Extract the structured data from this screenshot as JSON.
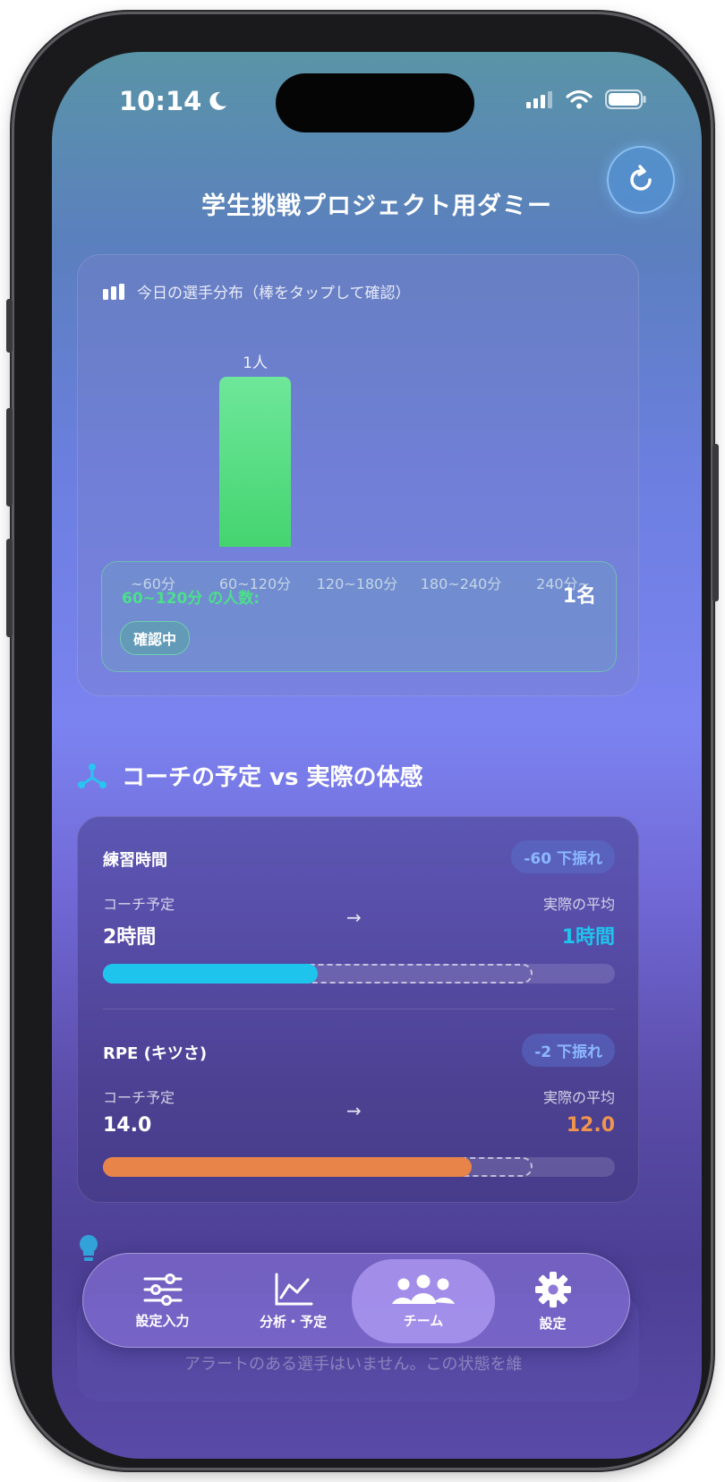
{
  "status_bar": {
    "time": "10:14"
  },
  "header": {
    "title": "学生挑戦プロジェクト用ダミー"
  },
  "distribution": {
    "title": "今日の選手分布（棒をタップして確認）",
    "selected_label": "60~120分 の人数:",
    "selected_value": "1名",
    "badge": "確認中"
  },
  "chart_data": {
    "type": "bar",
    "title": "今日の選手分布（棒をタップして確認）",
    "categories": [
      "~60分",
      "60~120分",
      "120~180分",
      "180~240分",
      "240分~"
    ],
    "values": [
      0,
      1,
      0,
      0,
      0
    ],
    "data_labels": [
      "",
      "1人",
      "",
      "",
      ""
    ],
    "ylim": [
      0,
      1
    ],
    "grid": false,
    "colors": {
      "bar": "#4cd67a"
    }
  },
  "comparison": {
    "section_title": "コーチの予定 vs 実際の体感",
    "metrics": [
      {
        "name": "練習時間",
        "badge": "-60 下振れ",
        "planned_label": "コーチ予定",
        "planned_value": "2時間",
        "arrow": "→",
        "actual_label": "実際の平均",
        "actual_value": "1時間",
        "planned_fraction": 0.84,
        "actual_fraction": 0.42,
        "color": "#1fc4ec"
      },
      {
        "name": "RPE (キツさ)",
        "badge": "-2 下振れ",
        "planned_label": "コーチ予定",
        "planned_value": "14.0",
        "arrow": "→",
        "actual_label": "実際の平均",
        "actual_value": "12.0",
        "planned_fraction": 0.84,
        "actual_fraction": 0.72,
        "color": "#e8834a"
      }
    ]
  },
  "below": {
    "text": "アラートのある選手はいません。この状態を維"
  },
  "tabbar": {
    "tabs": [
      {
        "label": "設定入力",
        "icon": "sliders-icon"
      },
      {
        "label": "分析・予定",
        "icon": "line-chart-icon"
      },
      {
        "label": "チーム",
        "icon": "team-icon",
        "active": true
      },
      {
        "label": "設定",
        "icon": "gear-icon"
      }
    ]
  }
}
